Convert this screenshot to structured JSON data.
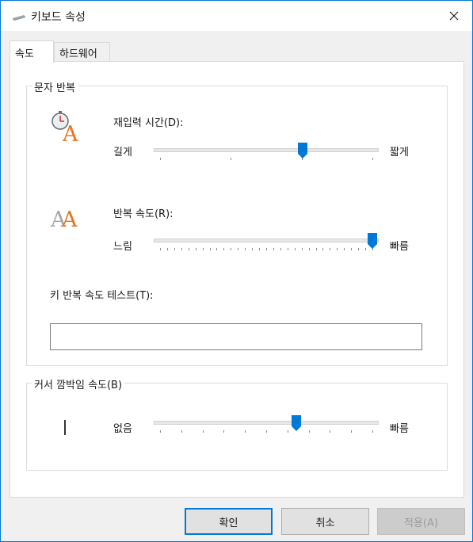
{
  "window": {
    "title": "키보드 속성",
    "close_icon": "close-icon"
  },
  "tabs": [
    {
      "label": "속도",
      "active": true
    },
    {
      "label": "하드웨어",
      "active": false
    }
  ],
  "char_repeat": {
    "group_label": "문자 반복",
    "repeat_delay": {
      "label": "재입력 시간(D):",
      "min_label": "길게",
      "max_label": "짧게",
      "value_fraction": 0.67
    },
    "repeat_rate": {
      "label": "반복 속도(R):",
      "min_label": "느림",
      "max_label": "빠름",
      "value_fraction": 1.0
    },
    "test_label": "키 반복 속도 테스트(T):",
    "test_value": ""
  },
  "cursor_blink": {
    "group_label": "커서 깜박임 속도(B)",
    "min_label": "없음",
    "max_label": "빠름",
    "value_fraction": 0.64
  },
  "buttons": {
    "ok": "확인",
    "cancel": "취소",
    "apply": "적용(A)"
  },
  "colors": {
    "accent": "#0078d7",
    "icon_orange": "#e8741e"
  }
}
